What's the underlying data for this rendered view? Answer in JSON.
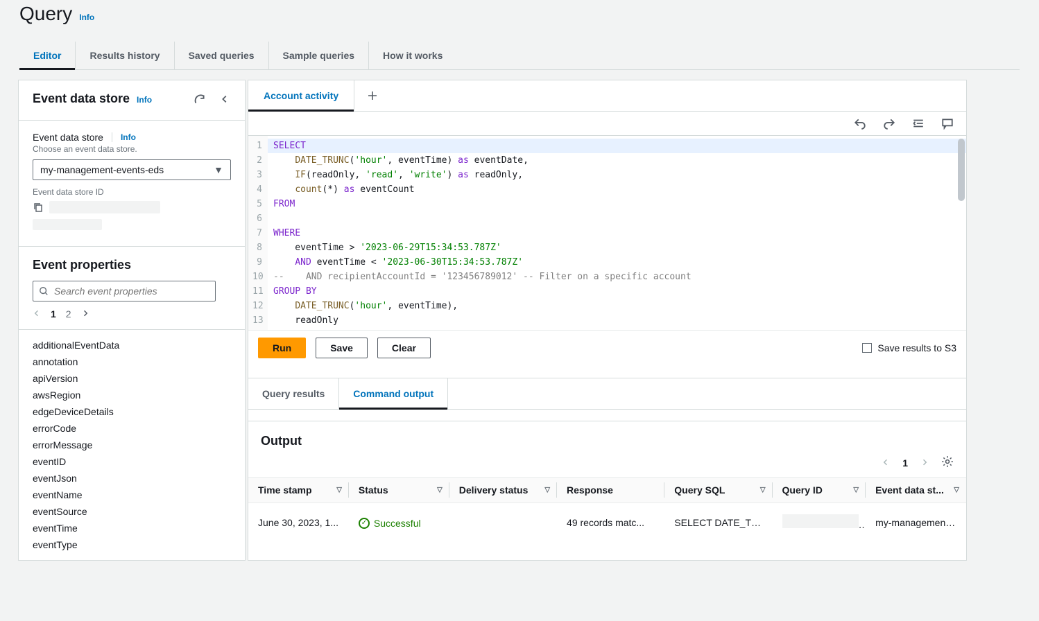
{
  "header": {
    "title": "Query",
    "info": "Info"
  },
  "tabs": {
    "editor": "Editor",
    "results_history": "Results history",
    "saved_queries": "Saved queries",
    "sample_queries": "Sample queries",
    "how_it_works": "How it works"
  },
  "sidebar": {
    "title": "Event data store",
    "info": "Info",
    "field_label": "Event data store",
    "field_info": "Info",
    "field_desc": "Choose an event data store.",
    "selected": "my-management-events-eds",
    "id_label": "Event data store ID",
    "props_title": "Event properties",
    "search_placeholder": "Search event properties",
    "pager": {
      "p1": "1",
      "p2": "2"
    },
    "props": [
      "additionalEventData",
      "annotation",
      "apiVersion",
      "awsRegion",
      "edgeDeviceDetails",
      "errorCode",
      "errorMessage",
      "eventID",
      "eventJson",
      "eventName",
      "eventSource",
      "eventTime",
      "eventType"
    ]
  },
  "editor": {
    "tab_label": "Account activity",
    "code_lines": [
      "SELECT",
      "    DATE_TRUNC('hour', eventTime) as eventDate,",
      "    IF(readOnly, 'read', 'write') as readOnly,",
      "    count(*) as eventCount",
      "FROM",
      "    ",
      "WHERE",
      "    eventTime > '2023-06-29T15:34:53.787Z'",
      "    AND eventTime < '2023-06-30T15:34:53.787Z'",
      "--    AND recipientAccountId = '123456789012' -- Filter on a specific account",
      "GROUP BY",
      "    DATE_TRUNC('hour', eventTime),",
      "    readOnly"
    ],
    "buttons": {
      "run": "Run",
      "save": "Save",
      "clear": "Clear",
      "save_s3": "Save results to S3"
    }
  },
  "results": {
    "tab_query": "Query results",
    "tab_command": "Command output",
    "output_title": "Output",
    "page": "1",
    "columns": {
      "timestamp": "Time stamp",
      "status": "Status",
      "delivery": "Delivery status",
      "response": "Response",
      "sql": "Query SQL",
      "query_id": "Query ID",
      "eds": "Event data st..."
    },
    "row": {
      "timestamp": "June 30, 2023, 1...",
      "status": "Successful",
      "delivery": "",
      "response": "49 records matc...",
      "sql": "SELECT DATE_TRUNC(",
      "eds": "my-management-even"
    }
  }
}
